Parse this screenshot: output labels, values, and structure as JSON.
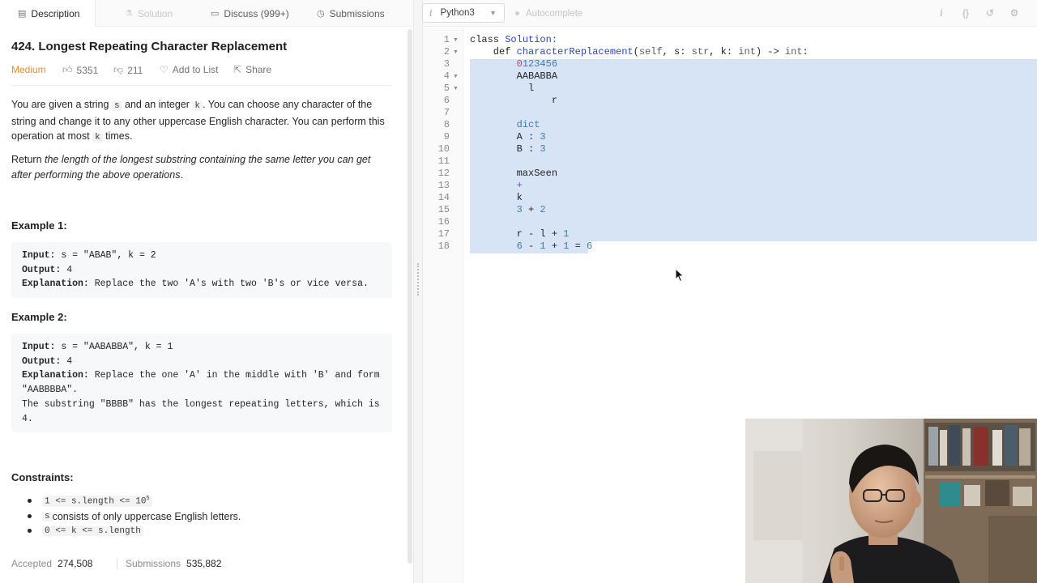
{
  "tabs": [
    {
      "label": "Description",
      "icon": "description-icon",
      "active": true
    },
    {
      "label": "Solution",
      "icon": "solution-icon",
      "disabled": true
    },
    {
      "label": "Discuss (999+)",
      "icon": "discuss-icon"
    },
    {
      "label": "Submissions",
      "icon": "submissions-icon"
    }
  ],
  "problem": {
    "title": "424. Longest Repeating Character Replacement",
    "difficulty": "Medium",
    "likes": "5351",
    "dislikes": "211",
    "add_to_list": "Add to List",
    "share": "Share",
    "p1_a": "You are given a string ",
    "p1_s": "s",
    "p1_b": " and an integer ",
    "p1_k": "k",
    "p1_c": ". You can choose any character of the string and change it to any other uppercase English character. You can perform this operation at most ",
    "p1_k2": "k",
    "p1_d": " times.",
    "p2_a": "Return ",
    "p2_b": "the length of the longest substring containing the same letter you can get after performing the above operations",
    "p2_c": "."
  },
  "examples": [
    {
      "heading": "Example 1:",
      "lines": [
        {
          "label": "Input:",
          "text": " s = \"ABAB\", k = 2"
        },
        {
          "label": "Output:",
          "text": " 4"
        },
        {
          "label": "Explanation:",
          "text": " Replace the two 'A's with two 'B's or vice versa."
        }
      ]
    },
    {
      "heading": "Example 2:",
      "lines": [
        {
          "label": "Input:",
          "text": " s = \"AABABBA\", k = 1"
        },
        {
          "label": "Output:",
          "text": " 4"
        },
        {
          "label": "Explanation:",
          "text": " Replace the one 'A' in the middle with 'B' and form"
        },
        {
          "label": "",
          "text": "\"AABBBBA\"."
        },
        {
          "label": "",
          "text": "The substring \"BBBB\" has the longest repeating letters, which is"
        },
        {
          "label": "",
          "text": "4."
        }
      ]
    }
  ],
  "constraints": {
    "heading": "Constraints:",
    "c1": "1 <= s.length <= 10",
    "c1_sup": "5",
    "c2_code": "s",
    "c2_text": " consists of only uppercase English letters.",
    "c3": "0 <= k <= s.length"
  },
  "stats": {
    "accepted_label": "Accepted",
    "accepted_value": "274,508",
    "submissions_label": "Submissions",
    "submissions_value": "535,882"
  },
  "editor": {
    "language": "Python3",
    "autocomplete": "Autocomplete",
    "toolbar_icons": [
      "info-icon",
      "braces-icon",
      "reset-icon",
      "settings-icon"
    ]
  },
  "code": {
    "line_numbers": [
      "1",
      "2",
      "3",
      "4",
      "5",
      "6",
      "7",
      "8",
      "9",
      "10",
      "11",
      "12",
      "13",
      "14",
      "15",
      "16",
      "17",
      "18"
    ],
    "folded_lines": [
      "1",
      "2",
      "4",
      "5"
    ],
    "l1": {
      "a": "class ",
      "b": "Solution:"
    },
    "l2": {
      "a": "    def ",
      "b": "characterReplacement",
      "c": "(",
      "d": "self",
      "e": ", s: ",
      "f": "str",
      "g": ", k: ",
      "h": "int",
      "i": ") -> ",
      "j": "int",
      "k": ":"
    },
    "l3": {
      "a": "        ",
      "b": "0",
      "c": "123456"
    },
    "l4": "        AABABBA",
    "l5": "          l",
    "l6": "              r",
    "l7": "",
    "l8": {
      "a": "        ",
      "b": "dict"
    },
    "l9": {
      "a": "        A : ",
      "b": "3"
    },
    "l10": {
      "a": "        B : ",
      "b": "3"
    },
    "l11": "",
    "l12": "        maxSeen",
    "l13": {
      "a": "        ",
      "b": "+"
    },
    "l14": "        k",
    "l15": {
      "a": "        ",
      "b": "3",
      "c": " + ",
      "d": "2"
    },
    "l16": "",
    "l17": {
      "a": "        r - l + ",
      "b": "1"
    },
    "l18": {
      "a": "        ",
      "b": "6",
      "c": " - ",
      "d": "1",
      "e": " + ",
      "f": "1",
      "g": " = ",
      "h": "6"
    }
  },
  "colors": {
    "accent_difficulty": "#ef8c2a",
    "selection": "#d7e4f6",
    "keyword_blue": "#2c46b8",
    "number_teal": "#3d7ea6"
  }
}
